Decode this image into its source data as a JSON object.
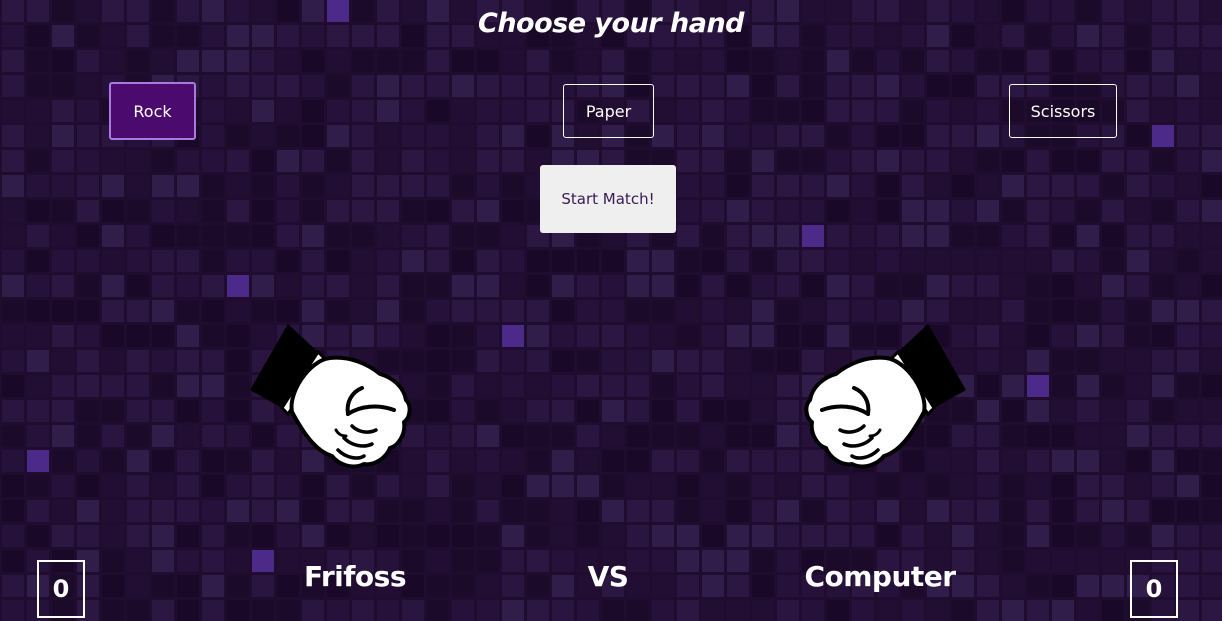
{
  "header": {
    "title": "Choose your hand"
  },
  "choices": {
    "rock_label": "Rock",
    "paper_label": "Paper",
    "scissors_label": "Scissors",
    "selected": "Rock"
  },
  "start_button": {
    "label": "Start Match!"
  },
  "players": {
    "player_name": "Frifoss",
    "vs_label": "VS",
    "computer_name": "Computer",
    "player_score": "0",
    "computer_score": "0"
  },
  "hands": {
    "player": "fist-icon",
    "computer": "fist-icon"
  },
  "colors": {
    "background": "#1f0c2e",
    "selected_button": "#4a0a6e",
    "selected_border": "#a87ae0",
    "highlight_tile": "#4b2a8a"
  }
}
